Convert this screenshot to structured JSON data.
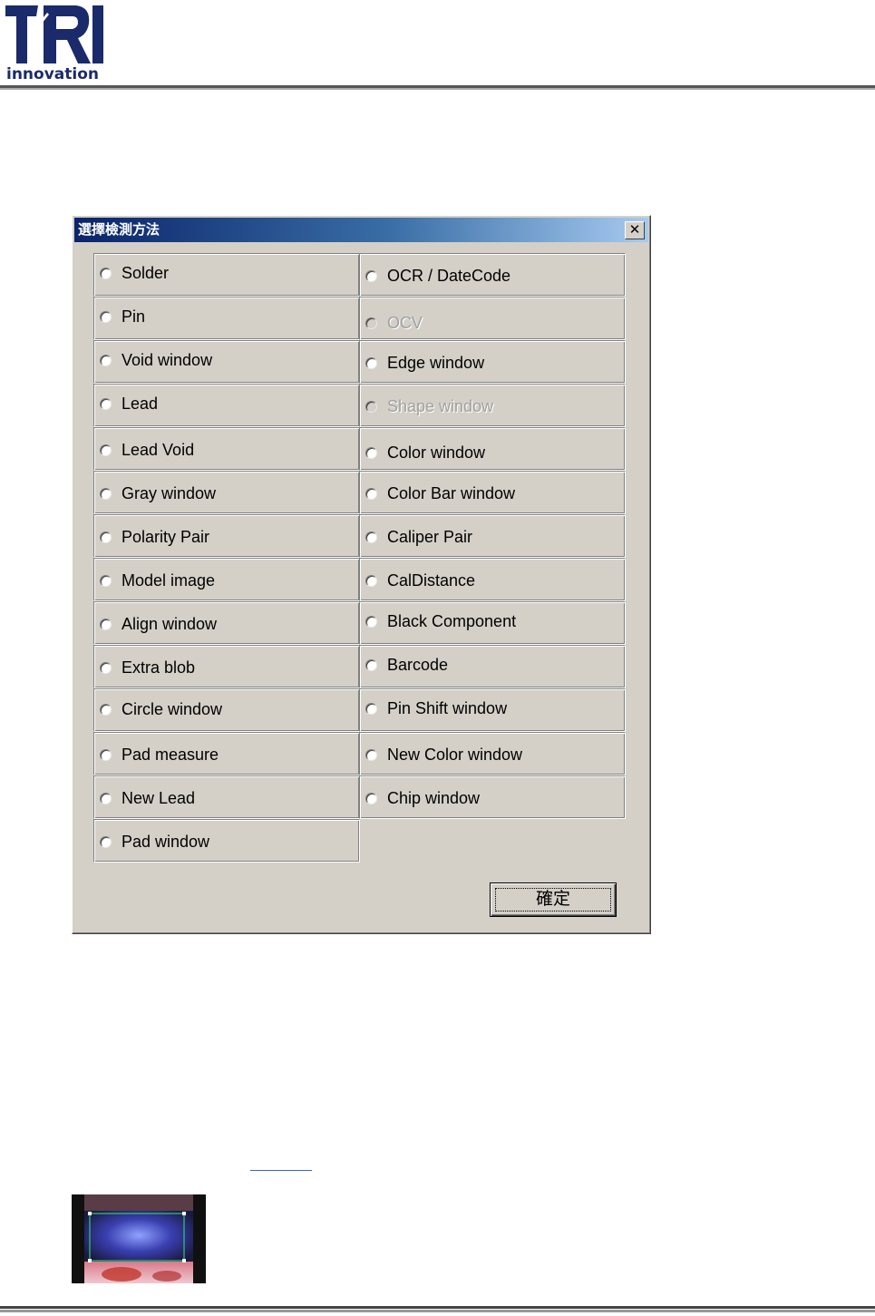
{
  "header": {
    "logo_letters": "TRI",
    "logo_word": "innovation",
    "brand_color": "#1b2a6b"
  },
  "dialog": {
    "title": "選擇檢測方法",
    "close_label": "✕",
    "title_gradient": [
      "#0a246a",
      "#a6caf0"
    ],
    "left_column": [
      {
        "label": "Solder",
        "enabled": true,
        "selected": false
      },
      {
        "label": "Pin",
        "enabled": true,
        "selected": false
      },
      {
        "label": "Void window",
        "enabled": true,
        "selected": false
      },
      {
        "label": "Lead",
        "enabled": true,
        "selected": false
      },
      {
        "label": "Lead Void",
        "enabled": true,
        "selected": false
      },
      {
        "label": "Gray window",
        "enabled": true,
        "selected": false
      },
      {
        "label": "Polarity Pair",
        "enabled": true,
        "selected": false
      },
      {
        "label": "Model image",
        "enabled": true,
        "selected": false
      },
      {
        "label": "Align window",
        "enabled": true,
        "selected": false
      },
      {
        "label": "Extra blob",
        "enabled": true,
        "selected": false
      },
      {
        "label": "Circle window",
        "enabled": true,
        "selected": false
      },
      {
        "label": "Pad measure",
        "enabled": true,
        "selected": false
      },
      {
        "label": "New Lead",
        "enabled": true,
        "selected": false
      },
      {
        "label": "Pad window",
        "enabled": true,
        "selected": false
      }
    ],
    "right_column": [
      {
        "label": "OCR / DateCode",
        "enabled": true,
        "selected": false
      },
      {
        "label": "OCV",
        "enabled": false,
        "selected": false
      },
      {
        "label": "Edge window",
        "enabled": true,
        "selected": false
      },
      {
        "label": "Shape window",
        "enabled": false,
        "selected": false
      },
      {
        "label": "Color window",
        "enabled": true,
        "selected": false
      },
      {
        "label": "Color Bar window",
        "enabled": true,
        "selected": false
      },
      {
        "label": "Caliper Pair",
        "enabled": true,
        "selected": false
      },
      {
        "label": "CalDistance",
        "enabled": true,
        "selected": false
      },
      {
        "label": "Black Component",
        "enabled": true,
        "selected": false
      },
      {
        "label": "Barcode",
        "enabled": true,
        "selected": false
      },
      {
        "label": "Pin Shift window",
        "enabled": true,
        "selected": false
      },
      {
        "label": "New Color window",
        "enabled": true,
        "selected": false
      },
      {
        "label": "Chip window",
        "enabled": true,
        "selected": false
      }
    ],
    "ok_label": "確定"
  }
}
